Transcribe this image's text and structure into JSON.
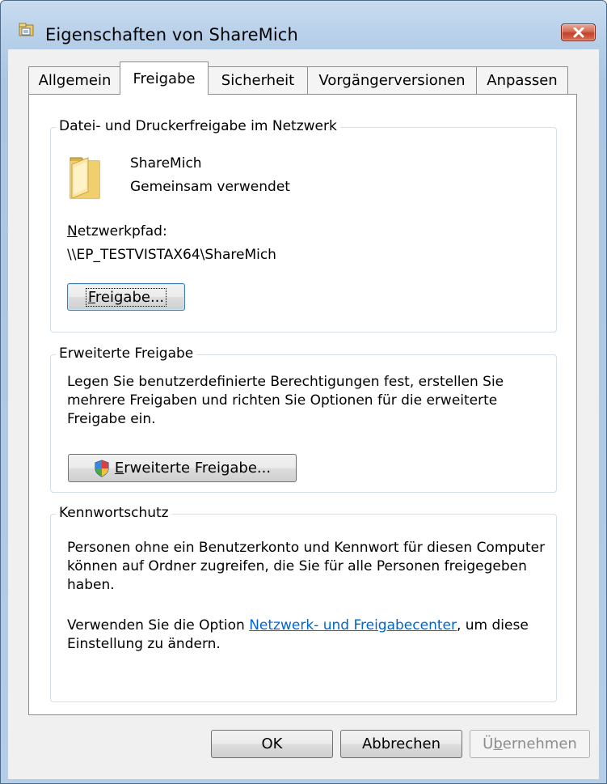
{
  "window": {
    "title": "Eigenschaften von ShareMich",
    "close_icon": "close-icon"
  },
  "tabs": [
    {
      "label": "Allgemein",
      "selected": false
    },
    {
      "label": "Freigabe",
      "selected": true
    },
    {
      "label": "Sicherheit",
      "selected": false
    },
    {
      "label": "Vorgängerversionen",
      "selected": false
    },
    {
      "label": "Anpassen",
      "selected": false
    }
  ],
  "sharing": {
    "legend": "Datei- und Druckerfreigabe im Netzwerk",
    "folder_icon": "folder-icon",
    "folder_name": "ShareMich",
    "status": "Gemeinsam verwendet",
    "path_label_mnemonic": "N",
    "path_label_rest": "etzwerkpfad:",
    "path_value": "\\\\EP_TESTVISTAX64\\ShareMich",
    "button_mnemonic": "F",
    "button_rest": "reigabe..."
  },
  "advanced": {
    "legend": "Erweiterte Freigabe",
    "description": "Legen Sie benutzerdefinierte Berechtigungen fest, erstellen Sie mehrere Freigaben und richten Sie Optionen für die erweiterte Freigabe ein.",
    "shield_icon": "uac-shield-icon",
    "button_mnemonic": "E",
    "button_rest": "rweiterte Freigabe..."
  },
  "password": {
    "legend": "Kennwortschutz",
    "description": "Personen ohne ein Benutzerkonto und Kennwort für diesen Computer können auf Ordner zugreifen, die Sie für alle Personen freigegeben haben.",
    "hint_before": "Verwenden Sie die Option ",
    "hint_link": "Netzwerk- und Freigabecenter",
    "hint_after": ", um diese Einstellung zu ändern."
  },
  "footer": {
    "ok": "OK",
    "cancel": "Abbrechen",
    "apply_mnemonic": "Ü",
    "apply_rest_u": "b",
    "apply_rest": "ernehmen"
  },
  "colors": {
    "link": "#0066cc",
    "close_button": "#c2412a"
  }
}
